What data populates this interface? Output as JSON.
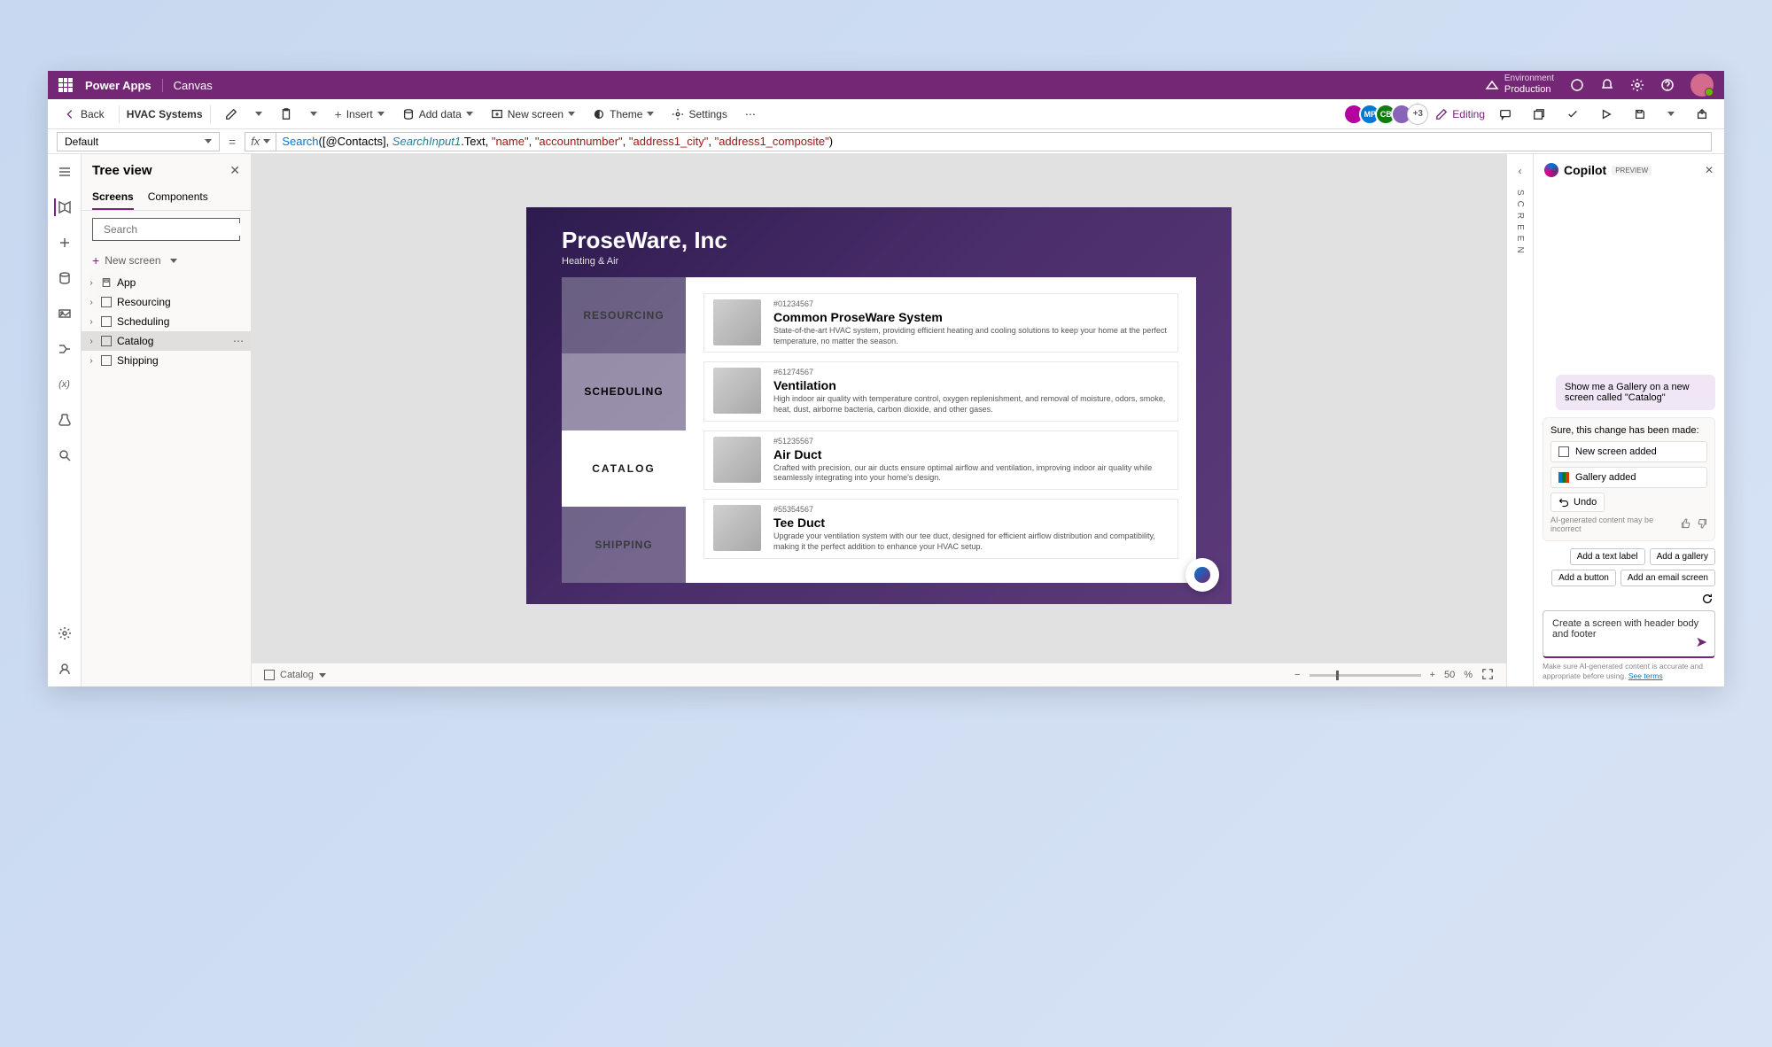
{
  "titlebar": {
    "brand": "Power Apps",
    "mode": "Canvas",
    "env_label": "Environment",
    "env_name": "Production"
  },
  "cmdbar": {
    "back": "Back",
    "app_name": "HVAC Systems",
    "insert": "Insert",
    "add_data": "Add data",
    "new_screen": "New screen",
    "theme": "Theme",
    "settings": "Settings",
    "presence_more": "+3",
    "editing": "Editing"
  },
  "formula": {
    "property": "Default"
  },
  "treeview": {
    "title": "Tree view",
    "tab_screens": "Screens",
    "tab_components": "Components",
    "search_ph": "Search",
    "new_screen": "New screen",
    "nodes": [
      {
        "label": "App"
      },
      {
        "label": "Resourcing"
      },
      {
        "label": "Scheduling"
      },
      {
        "label": "Catalog"
      },
      {
        "label": "Shipping"
      }
    ]
  },
  "canvas": {
    "company": "ProseWare, Inc",
    "subtitle": "Heating & Air",
    "nav": [
      "RESOURCING",
      "SCHEDULING",
      "CATALOG",
      "SHIPPING"
    ],
    "products": [
      {
        "sku": "#01234567",
        "name": "Common ProseWare System",
        "desc": "State-of-the-art HVAC system, providing efficient heating and cooling solutions to keep your home at the perfect temperature, no matter the season."
      },
      {
        "sku": "#61274567",
        "name": "Ventilation",
        "desc": "High indoor air quality with temperature control, oxygen replenishment, and removal of moisture, odors, smoke, heat, dust, airborne bacteria, carbon dioxide, and other gases."
      },
      {
        "sku": "#51235567",
        "name": "Air Duct",
        "desc": "Crafted with precision, our air ducts ensure optimal airflow and ventilation, improving indoor air quality while seamlessly integrating into your home's design."
      },
      {
        "sku": "#55354567",
        "name": "Tee Duct",
        "desc": "Upgrade your ventilation system with our tee duct, designed for efficient airflow distribution and compatibility, making it the perfect addition to enhance your HVAC setup."
      }
    ]
  },
  "status": {
    "screen": "Catalog",
    "zoom": "50",
    "zoom_unit": "%"
  },
  "rightedge": {
    "label": "SCREEN"
  },
  "copilot": {
    "title": "Copilot",
    "badge": "PREVIEW",
    "user_msg": "Show me a Gallery on a new screen called \"Catalog\"",
    "assist_title": "Sure, this change has been made:",
    "card1": "New screen added",
    "card2": "Gallery added",
    "undo": "Undo",
    "disclaimer_small": "AI-generated content may be incorrect",
    "suggestions": [
      "Add a text label",
      "Add a gallery",
      "Add a button",
      "Add an email screen"
    ],
    "input_text": "Create a screen with header body and footer",
    "footer": "Make sure AI-generated content is accurate and appropriate before using. ",
    "footer_link": "See terms"
  }
}
